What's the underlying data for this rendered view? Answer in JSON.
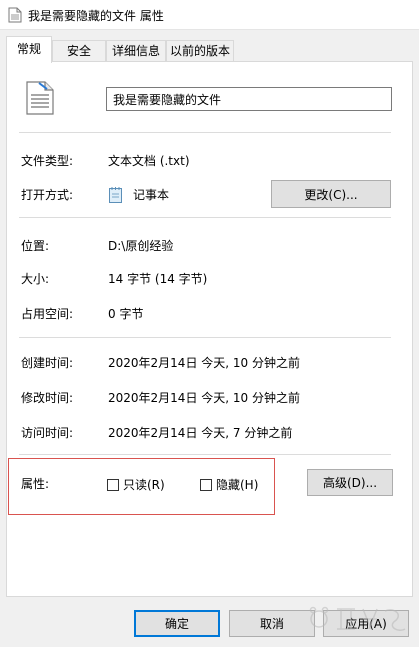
{
  "window": {
    "title": "我是需要隐藏的文件 属性"
  },
  "tabs": [
    {
      "label": "常规"
    },
    {
      "label": "安全"
    },
    {
      "label": "详细信息"
    },
    {
      "label": "以前的版本"
    }
  ],
  "general": {
    "file_name": "我是需要隐藏的文件",
    "file_type_label": "文件类型:",
    "file_type_value": "文本文档 (.txt)",
    "open_with_label": "打开方式:",
    "open_with_value": "记事本",
    "change_button": "更改(C)...",
    "location_label": "位置:",
    "location_value": "D:\\原创经验",
    "size_label": "大小:",
    "size_value": "14 字节 (14 字节)",
    "disk_size_label": "占用空间:",
    "disk_size_value": "0 字节",
    "created_label": "创建时间:",
    "created_value": "2020年2月14日 今天, 10 分钟之前",
    "modified_label": "修改时间:",
    "modified_value": "2020年2月14日 今天, 10 分钟之前",
    "accessed_label": "访问时间:",
    "accessed_value": "2020年2月14日 今天, 7 分钟之前",
    "attributes_label": "属性:",
    "readonly_label": "只读(R)",
    "readonly_checked": false,
    "hidden_label": "隐藏(H)",
    "hidden_checked": false,
    "advanced_button": "高级(D)..."
  },
  "footer": {
    "ok_button": "确定",
    "cancel_button": "取消",
    "apply_button": "应用(A)"
  },
  "colors": {
    "highlight_box": "#d9534f",
    "primary_button_border": "#0078d7"
  }
}
